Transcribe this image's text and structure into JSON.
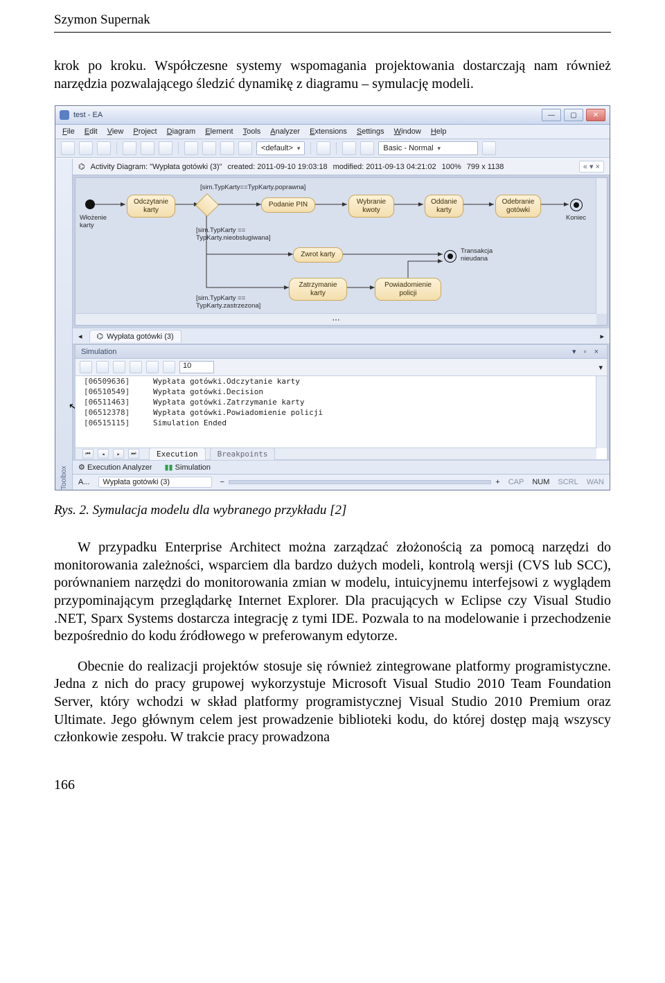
{
  "running_head": "Szymon Supernak",
  "para_intro": "krok po kroku. Współczesne systemy wspomagania projektowania dostarczają nam również narzędzia pozwalającego śledzić dynamikę z diagramu – symulację modeli.",
  "figure": {
    "caption": "Rys. 2. Symulacja modelu dla wybranego przykładu [2]",
    "title": "test - EA",
    "menubar": [
      "File",
      "Edit",
      "View",
      "Project",
      "Diagram",
      "Element",
      "Tools",
      "Analyzer",
      "Extensions",
      "Settings",
      "Window",
      "Help"
    ],
    "toolbar": {
      "combo_default": "<default>",
      "combo_view": "Basic - Normal"
    },
    "docheader": {
      "prefix": "Activity Diagram: \"Wypłata gotówki (3)\"",
      "created": "created: 2011-09-10 19:03:18",
      "modified": "modified: 2011-09-13 04:21:02",
      "zoom": "100%",
      "size": "799 x 1138"
    },
    "toolbox_label": "Toolbox",
    "diagram": {
      "start_label": "Włożenie\nkarty",
      "end_label": "Koniec",
      "guard_top": "[sim.TypKarty==TypKarty.poprawna]",
      "guard_mid": "[sim.TypKarty ==\nTypKarty.nieobslugiwana]",
      "guard_bot": "[sim.TypKarty ==\nTypKarty.zastrzezona]",
      "trans_label": "Transakcja\nnieudana",
      "nodes": {
        "odczytanie": "Odczytanie\nkarty",
        "podanie": "Podanie PIN",
        "wybranie": "Wybranie\nkwoty",
        "oddanie": "Oddanie\nkarty",
        "odebranie": "Odebranie\ngotówki",
        "zwrot": "Zwrot karty",
        "zatrzymanie": "Zatrzymanie\nkarty",
        "powiadomienie": "Powiadomienie\npolicji"
      }
    },
    "diagram_tab": "Wypłata gotówki (3)",
    "sim_panel": "Simulation",
    "sim_speed": "10",
    "log": [
      {
        "ts": "[06509636]",
        "msg": "Wypłata gotówki.Odczytanie karty"
      },
      {
        "ts": "[06510549]",
        "msg": "Wypłata gotówki.Decision"
      },
      {
        "ts": "[06511463]",
        "msg": "Wypłata gotówki.Zatrzymanie karty"
      },
      {
        "ts": "[06512378]",
        "msg": "Wypłata gotówki.Powiadomienie policji"
      },
      {
        "ts": "[06515115]",
        "msg": "Simulation Ended"
      }
    ],
    "log_tabs": {
      "exec": "Execution",
      "break": "Breakpoints"
    },
    "bottom_tabs": {
      "analyzer": "Execution Analyzer",
      "sim": "Simulation"
    },
    "status": {
      "a": "A...",
      "doc": "Wypłata gotówki (3)",
      "cap": "CAP",
      "num": "NUM",
      "scrl": "SCRL",
      "wan": "WAN",
      "minus": "−",
      "plus": "+"
    }
  },
  "para_body1": "W przypadku Enterprise Architect można zarządzać złożonością za pomocą narzędzi do monitorowania zależności, wsparciem dla bardzo dużych modeli, kontrolą wersji (CVS lub SCC), porównaniem narzędzi do monitorowania zmian w modelu, intuicyjnemu interfejsowi z wyglądem przypominającym przeglądarkę Internet Explorer. Dla pracujących w Eclipse czy Visual Studio .NET, Sparx Systems dostarcza integrację z tymi IDE. Pozwala to na modelowanie i przechodzenie bezpośrednio do kodu źródłowego w preferowanym edytorze.",
  "para_body2": "Obecnie do realizacji projektów stosuje się również zintegrowane platformy programistyczne. Jedna z nich do pracy grupowej wykorzystuje Microsoft Visual Studio 2010 Team Foundation Server, który wchodzi w skład platformy programistycznej Visual Studio 2010 Premium oraz Ultimate. Jego głównym celem jest prowadzenie biblioteki kodu, do której dostęp mają wszyscy członkowie zespołu. W trakcie pracy prowadzona",
  "page_number": "166"
}
